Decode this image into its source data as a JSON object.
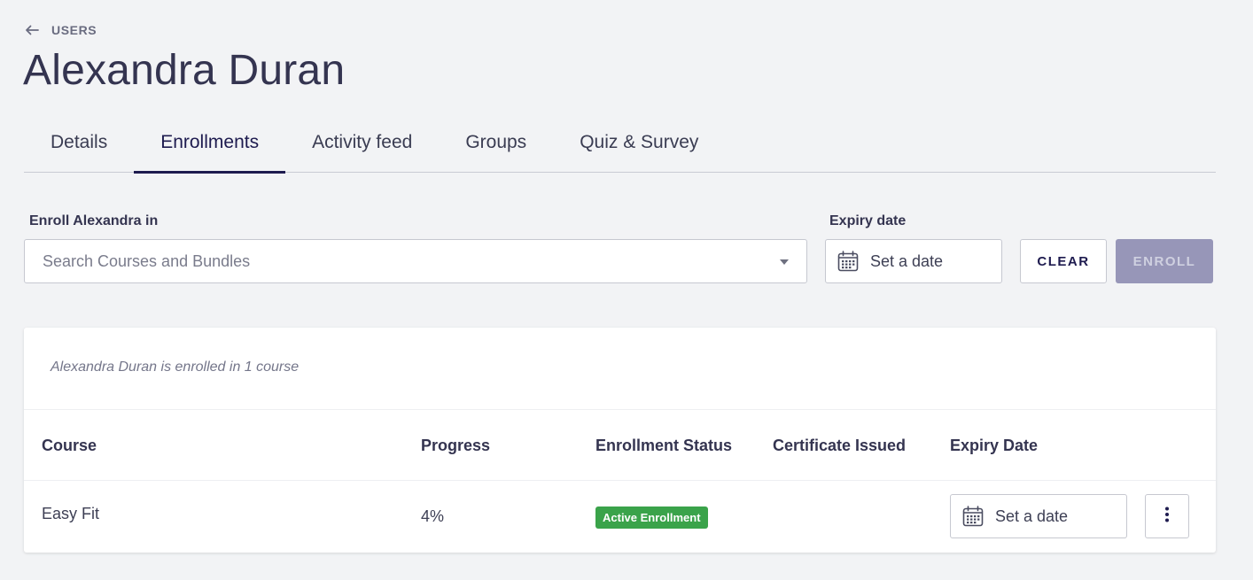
{
  "breadcrumb": {
    "label": "USERS",
    "icon": "arrow-left-icon"
  },
  "page_title": "Alexandra Duran",
  "tabs": [
    {
      "label": "Details",
      "active": false
    },
    {
      "label": "Enrollments",
      "active": true
    },
    {
      "label": "Activity feed",
      "active": false
    },
    {
      "label": "Groups",
      "active": false
    },
    {
      "label": "Quiz & Survey",
      "active": false
    }
  ],
  "enroll": {
    "label": "Enroll Alexandra in",
    "search_placeholder": "Search Courses and Bundles",
    "expiry_label": "Expiry date",
    "expiry_placeholder": "Set a date",
    "clear_label": "CLEAR",
    "enroll_label": "ENROLL"
  },
  "enrollments": {
    "summary": "Alexandra Duran is enrolled in 1 course",
    "columns": [
      "Course",
      "Progress",
      "Enrollment Status",
      "Certificate Issued",
      "Expiry Date"
    ],
    "rows": [
      {
        "course": "Easy Fit",
        "progress": "4%",
        "status": "Active Enrollment",
        "certificate": "",
        "expiry_placeholder": "Set a date"
      }
    ]
  },
  "colors": {
    "primary": "#1e1b4f",
    "disabled_button": "#9796b8",
    "status_active": "#3aa34a",
    "background": "#f2f3f5"
  }
}
